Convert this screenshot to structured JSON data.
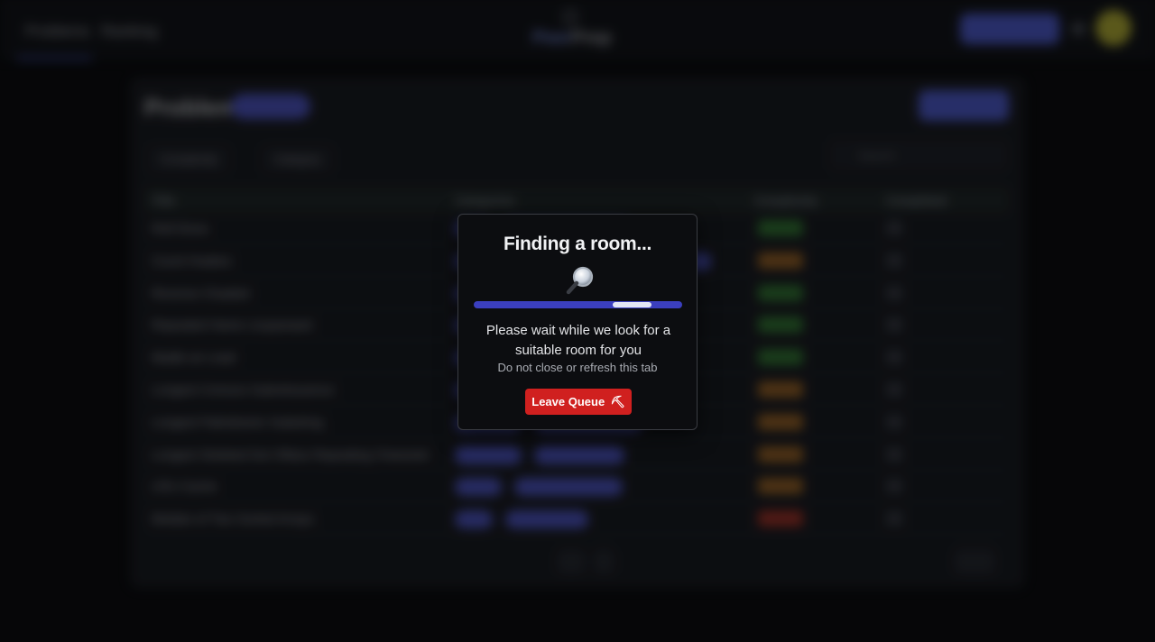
{
  "background_app": {
    "nav": [
      "Problems",
      "Ranking"
    ],
    "brand_part1": "Peer",
    "brand_part2": "Prep",
    "top_button": "",
    "page_title": "Problems",
    "filters": [
      "Complexity",
      "Category"
    ],
    "search_placeholder": "Search",
    "columns": [
      "Title",
      "Categories",
      "Complexity",
      "Completed"
    ],
    "rows": [
      {
        "title": "Roll Dices",
        "difficulty_color": "#3a8f3a"
      },
      {
        "title": "Count Hoakes",
        "difficulty_color": "#b8752a"
      },
      {
        "title": "Reverse Chaaled",
        "difficulty_color": "#3a8f3a"
      },
      {
        "title": "Repeated Hame Lisupseaed",
        "difficulty_color": "#3a8f3a"
      },
      {
        "title": "Madle an Lead",
        "difficulty_color": "#3a8f3a"
      },
      {
        "title": "Longest Cnmuns Subrelssuence",
        "difficulty_color": "#b8752a"
      },
      {
        "title": "Longest Palindramic Substring",
        "difficulty_color": "#b8752a"
      },
      {
        "title": "Longest Stoleted Dot Ofidus Repeating Character",
        "difficulty_color": "#b8752a"
      },
      {
        "title": "LRU Cache",
        "difficulty_color": "#b8752a"
      },
      {
        "title": "Median of Two Sorted Arrays",
        "difficulty_color": "#c0392b"
      }
    ]
  },
  "modal": {
    "title": "Finding a room...",
    "icon": "magnifier-icon",
    "progress": 0.85,
    "message": "Please wait while we look for a suitable room for you",
    "subtext": "Do not close or refresh this tab",
    "leave_button": "Leave Queue",
    "leave_icon": "⛏",
    "colors": {
      "button": "#d0201f",
      "progress_track": "#3b3fbf",
      "progress_highlight": "#e3e6f5"
    }
  }
}
